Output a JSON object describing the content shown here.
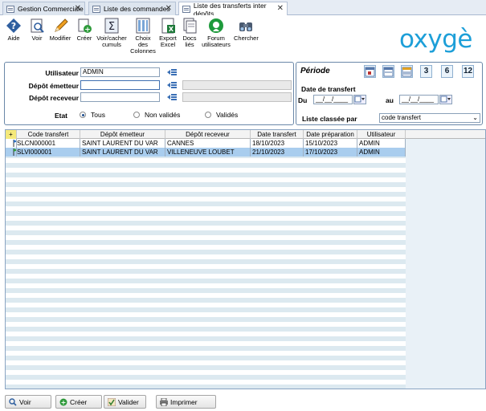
{
  "tabs": [
    {
      "label": "Gestion Commerciale"
    },
    {
      "label": "Liste des commandes"
    },
    {
      "label": "Liste des transferts inter dépôts"
    }
  ],
  "toolbar": {
    "aide": "Aide",
    "voir": "Voir",
    "modifier": "Modifier",
    "creer": "Créer",
    "voir_cacher_1": "Voir/cacher",
    "voir_cacher_2": "cumuls",
    "choix_1": "Choix",
    "choix_2": "des",
    "choix_3": "Colonnes",
    "export_1": "Export",
    "export_2": "Excel",
    "docs_1": "Docs",
    "docs_2": "liés",
    "forum_1": "Forum",
    "forum_2": "utilisateurs",
    "chercher": "Chercher"
  },
  "brand": "oxygè",
  "filters": {
    "utilisateur_label": "Utilisateur",
    "utilisateur_value": "ADMIN",
    "depot_emetteur_label": "Dépôt émetteur",
    "depot_emetteur_value": "",
    "depot_receveur_label": "Dépôt receveur",
    "depot_receveur_value": "",
    "etat_label": "Etat",
    "etat_options": [
      "Tous",
      "Non validés",
      "Validés"
    ],
    "etat_selected": "Tous"
  },
  "periode": {
    "title": "Période",
    "cal_buttons": [
      "3",
      "6",
      "12"
    ],
    "date_label": "Date de transfert",
    "du_label": "Du",
    "au_label": "au",
    "du_value": "__/__/____",
    "au_value": "__/__/____",
    "sort_label": "Liste classée par",
    "sort_value": "code transfert"
  },
  "grid": {
    "add_symbol": "+",
    "columns": [
      "Code transfert",
      "Dépôt émetteur",
      "Dépôt receveur",
      "Date transfert",
      "Date préparation",
      "Utilisateur"
    ],
    "rows": [
      {
        "code": "SLCN000001",
        "emetteur": "SAINT LAURENT DU VAR",
        "receveur": "CANNES",
        "date_transfert": "18/10/2023",
        "date_preparation": "15/10/2023",
        "utilisateur": "ADMIN",
        "selected": false,
        "flag_color": "#2f6fc0"
      },
      {
        "code": "SLVI000001",
        "emetteur": "SAINT LAURENT DU VAR",
        "receveur": "VILLENEUVE LOUBET",
        "date_transfert": "21/10/2023",
        "date_preparation": "17/10/2023",
        "utilisateur": "ADMIN",
        "selected": true,
        "flag_color": "#2e9a3a"
      }
    ]
  },
  "bottom_buttons": {
    "voir": "Voir",
    "creer": "Créer",
    "valider": "Valider",
    "imprimer": "Imprimer"
  },
  "colors": {
    "selection": "#a9cdee",
    "stripe": "#dce9f0",
    "brand": "#1d9fd8",
    "panel_border": "#6a88a8"
  }
}
